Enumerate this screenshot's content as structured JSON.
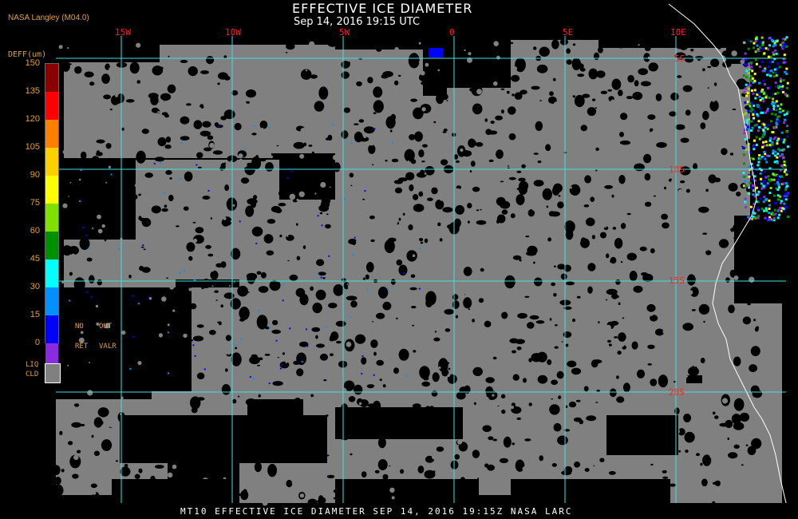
{
  "header": {
    "producer": "NASA Langley (M04.0)",
    "title": "EFFECTIVE ICE DIAMETER",
    "subtitle": "Sep 14, 2016 19:15 UTC"
  },
  "footer": {
    "text": "MT10  EFFECTIVE ICE DIAMETER  SEP 14, 2016 19:15Z  NASA LARC"
  },
  "grid": {
    "lon_labels": [
      "15W",
      "10W",
      "5W",
      "0",
      "5E",
      "10E"
    ],
    "lat_labels": [
      "5S",
      "10S",
      "15S",
      "20S"
    ],
    "line_color": "#40e0e0",
    "label_color": "#ff2020"
  },
  "legend": {
    "title": "DEFF(um)",
    "ticks": [
      "150",
      "135",
      "120",
      "105",
      "90",
      "75",
      "60",
      "45",
      "30",
      "15",
      "0"
    ],
    "colors": [
      "#8b0000",
      "#ff0000",
      "#ff8000",
      "#ffd000",
      "#ffff00",
      "#80e000",
      "#009000",
      "#00ffff",
      "#0090ff",
      "#0000ff",
      "#8a2be2"
    ],
    "no_ret": [
      "NO",
      "RET"
    ],
    "out_valr": [
      "OUT",
      "VALR"
    ],
    "liq_cld": [
      "LIQ",
      "CLD"
    ],
    "liq_color": "#808080"
  },
  "map": {
    "background": "#000000",
    "cloud_color": "#808080",
    "coast_color": "#ffffff"
  }
}
